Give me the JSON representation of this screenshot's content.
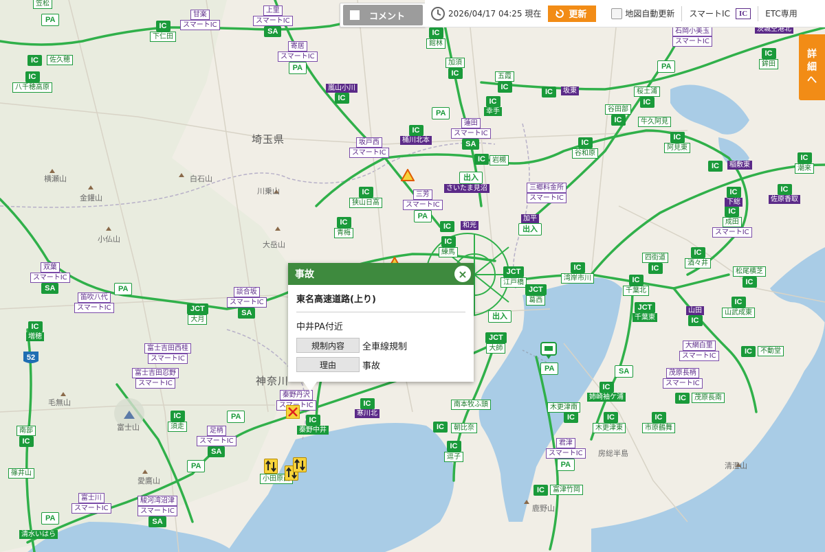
{
  "toolbar": {
    "comment_label": "コメント",
    "datetime": "2026/04/17 04:25 現在",
    "refresh_label": "更新",
    "auto_update_label": "地図自動更新",
    "smart_ic_label": "スマートIC",
    "smart_ic_icon": "IC",
    "etc_label": "ETC専用"
  },
  "detail_tab": {
    "chars": [
      "詳",
      "細",
      "へ"
    ]
  },
  "popup": {
    "title": "事故",
    "road": "東名高速道路(上り)",
    "location": "中井PA付近",
    "rows": [
      {
        "label": "規制内容",
        "value": "全車線規制"
      },
      {
        "label": "理由",
        "value": "事故"
      }
    ]
  },
  "places": {
    "saitama": "埼玉県",
    "kanagawa": "神奈川",
    "yokoseyama": "横瀬山",
    "kinkasan": "金鑵山",
    "hakuseki": "白石山",
    "kawanori": "川乗山",
    "otakesan": "大岳山",
    "kobotoke": "小仏山",
    "kenashi": "毛無山",
    "fujisan": "富士山",
    "ashitaka": "愛鷹山",
    "kanozan": "鹿野山",
    "kiyosumi": "清澄山",
    "boso": "房総半島"
  },
  "markers": {
    "kasamatsu": {
      "tag": "IC",
      "name": "笠松"
    },
    "saku_ic": {
      "tag": "IC",
      "name": "佐久穂"
    },
    "yachiho": {
      "tag": "IC",
      "name": "八千穂高原"
    },
    "kanra": {
      "tag": "",
      "name": "甘楽",
      "name2": "スマートIC"
    },
    "kamisato": {
      "tag": "",
      "name": "上里",
      "name2": "スマートIC",
      "tag2": "SA"
    },
    "shimonita": {
      "tag": "IC",
      "name": "下仁田"
    },
    "yorii": {
      "tag": "",
      "name": "寄居",
      "name2": "スマートIC",
      "tag2": "PA"
    },
    "ranzan": {
      "tag": "",
      "name": "嵐山小川"
    },
    "sakado": {
      "tag": "",
      "name": "坂戸西",
      "name2": "スマートIC"
    },
    "okegawa": {
      "tag": "IC",
      "name": "桶川北本"
    },
    "hasuda": {
      "tag": "",
      "name": "蓮田",
      "name2": "スマートIC",
      "tag2": "SA"
    },
    "kuki": {
      "tag": "IC",
      "name": "岩槻"
    },
    "sayama": {
      "tag": "IC",
      "name": "狭山日高"
    },
    "miyoshi": {
      "tag": "",
      "name": "三芳",
      "name2": "スマートIC",
      "tag2": "PA"
    },
    "saitamamisanuma": {
      "tag": "",
      "name": "さいたま見沼"
    },
    "misato": {
      "tag": "",
      "name": "三郷料金所",
      "name2": "スマートIC"
    },
    "ome": {
      "tag": "IC",
      "name": "青梅"
    },
    "wako": {
      "tag": "IC",
      "name": "和光"
    },
    "nerima": {
      "tag": "IC",
      "name": "練馬"
    },
    "kahei": {
      "tag": "",
      "name": "加平",
      "name2": "出入"
    },
    "futaba": {
      "tag": "",
      "name": "双葉",
      "name2": "スマートIC",
      "tag2": "SA"
    },
    "fuefuki": {
      "tag": "",
      "name": "笛吹八代",
      "name2": "スマートIC"
    },
    "dangozaka": {
      "tag": "",
      "name": "談合坂",
      "name2": "スマートIC",
      "tag2": "SA"
    },
    "otsuki": {
      "tag": "JCT",
      "name": "大月"
    },
    "masuho": {
      "tag": "IC",
      "name": "増穂"
    },
    "fujiyoshida": {
      "tag": "",
      "name": "富士吉田西桂",
      "name2": "スマートIC"
    },
    "oshino": {
      "tag": "",
      "name": "富士吉田忍野",
      "name2": "スマートIC"
    },
    "susono": {
      "tag": "IC",
      "name": "須走"
    },
    "ashigara": {
      "tag": "",
      "name": "足柄",
      "name2": "スマートIC",
      "tag2": "SA"
    },
    "nanbu": {
      "tag": "",
      "name": "南部",
      "name2": "IC"
    },
    "fujikawa": {
      "tag": "",
      "name": "富士川",
      "name2": "スマートIC"
    },
    "surugawan": {
      "tag": "",
      "name": "駿河湾沼津",
      "name2": "スマートIC",
      "tag2": "SA"
    },
    "shimizu": {
      "tag": "",
      "name": "清水いはら"
    },
    "hadano": {
      "tag": "",
      "name": "秦野丹沢",
      "name2": "スマートIC"
    },
    "hadanonakai": {
      "tag": "IC",
      "name": "秦野中井"
    },
    "samukawa": {
      "tag": "",
      "name": "寒川北"
    },
    "odawara": {
      "tag": "",
      "name": "小田原西"
    },
    "edobashi": {
      "tag": "JCT",
      "name": "江戸橋"
    },
    "kasai": {
      "tag": "JCT",
      "name": "葛西"
    },
    "wangan": {
      "tag": "IC",
      "name": "湾岸市川"
    },
    "ooi": {
      "tag": "JCT",
      "name": "大師"
    },
    "minamihonmoku": {
      "tag": "",
      "name": "南本牧ふ頭"
    },
    "asahina": {
      "tag": "IC",
      "name": "朝比奈"
    },
    "zushi": {
      "tag": "IC",
      "name": "逗子"
    },
    "kisarazu": {
      "tag": "",
      "name": "木更津南"
    },
    "kisarazuhigashi": {
      "tag": "IC",
      "name": "木更津東"
    },
    "kimitsu": {
      "tag": "",
      "name": "君津",
      "name2": "スマートIC",
      "tag2": "PA"
    },
    "futtsu": {
      "tag": "IC",
      "name": "富津竹岡"
    },
    "anegasaki": {
      "tag": "",
      "name": "姉崎袖ケ浦"
    },
    "ichihara": {
      "tag": "IC",
      "name": "市原鶴舞"
    },
    "mobara": {
      "tag": "",
      "name": "茂原長柄",
      "name2": "スマートIC"
    },
    "mobaranan": {
      "tag": "IC",
      "name": "茂原長南"
    },
    "oamishirasato": {
      "tag": "",
      "name": "大網白里",
      "name2": "スマートIC"
    },
    "togane": {
      "tag": "IC",
      "name": "不動堂"
    },
    "yamada": {
      "tag": "",
      "name": "山田"
    },
    "sanbu": {
      "tag": "IC",
      "name": "山武成東"
    },
    "chibakita": {
      "tag": "IC",
      "name": "千葉北"
    },
    "chibahigashi": {
      "tag": "JCT",
      "name": "千葉東"
    },
    "yotsukaido": {
      "tag": "",
      "name": "四街道"
    },
    "shisui": {
      "tag": "IC",
      "name": "酒々井"
    },
    "narita": {
      "tag": "",
      "name": "成田",
      "name2": "スマートIC"
    },
    "shimofusa": {
      "tag": "",
      "name": "下総"
    },
    "matsuokoshiba": {
      "tag": "",
      "name": "松尾横芝"
    },
    "sawara": {
      "tag": "",
      "name": "佐原香取"
    },
    "itako": {
      "tag": "IC",
      "name": "潮来"
    },
    "inashiki": {
      "tag": "IC",
      "name": "稲敷東"
    },
    "ami": {
      "tag": "IC",
      "name": "阿見東"
    },
    "ushiku": {
      "tag": "IC",
      "name": "牛久阿見"
    },
    "yatabe": {
      "tag": "IC",
      "name": "谷田部"
    },
    "yawara": {
      "tag": "IC",
      "name": "谷和原"
    },
    "sakura": {
      "tag": "IC",
      "name": "桜土浦"
    },
    "bando": {
      "tag": "IC",
      "name": "坂東"
    },
    "goka": {
      "tag": "IC",
      "name": "五霞"
    },
    "satte": {
      "tag": "IC",
      "name": "幸手"
    },
    "kazo": {
      "tag": "IC",
      "name": "加須"
    },
    "tatebayashi": {
      "tag": "IC",
      "name": "館林"
    },
    "ishioka": {
      "tag": "",
      "name": "石岡小美玉",
      "name2": "スマートIC"
    },
    "hokota": {
      "tag": "IC",
      "name": "鉾田"
    },
    "ibarakikuko": {
      "tag": "",
      "name": "茨城空港北"
    },
    "parking_pa": {
      "tag": "PA",
      "name": ""
    }
  }
}
